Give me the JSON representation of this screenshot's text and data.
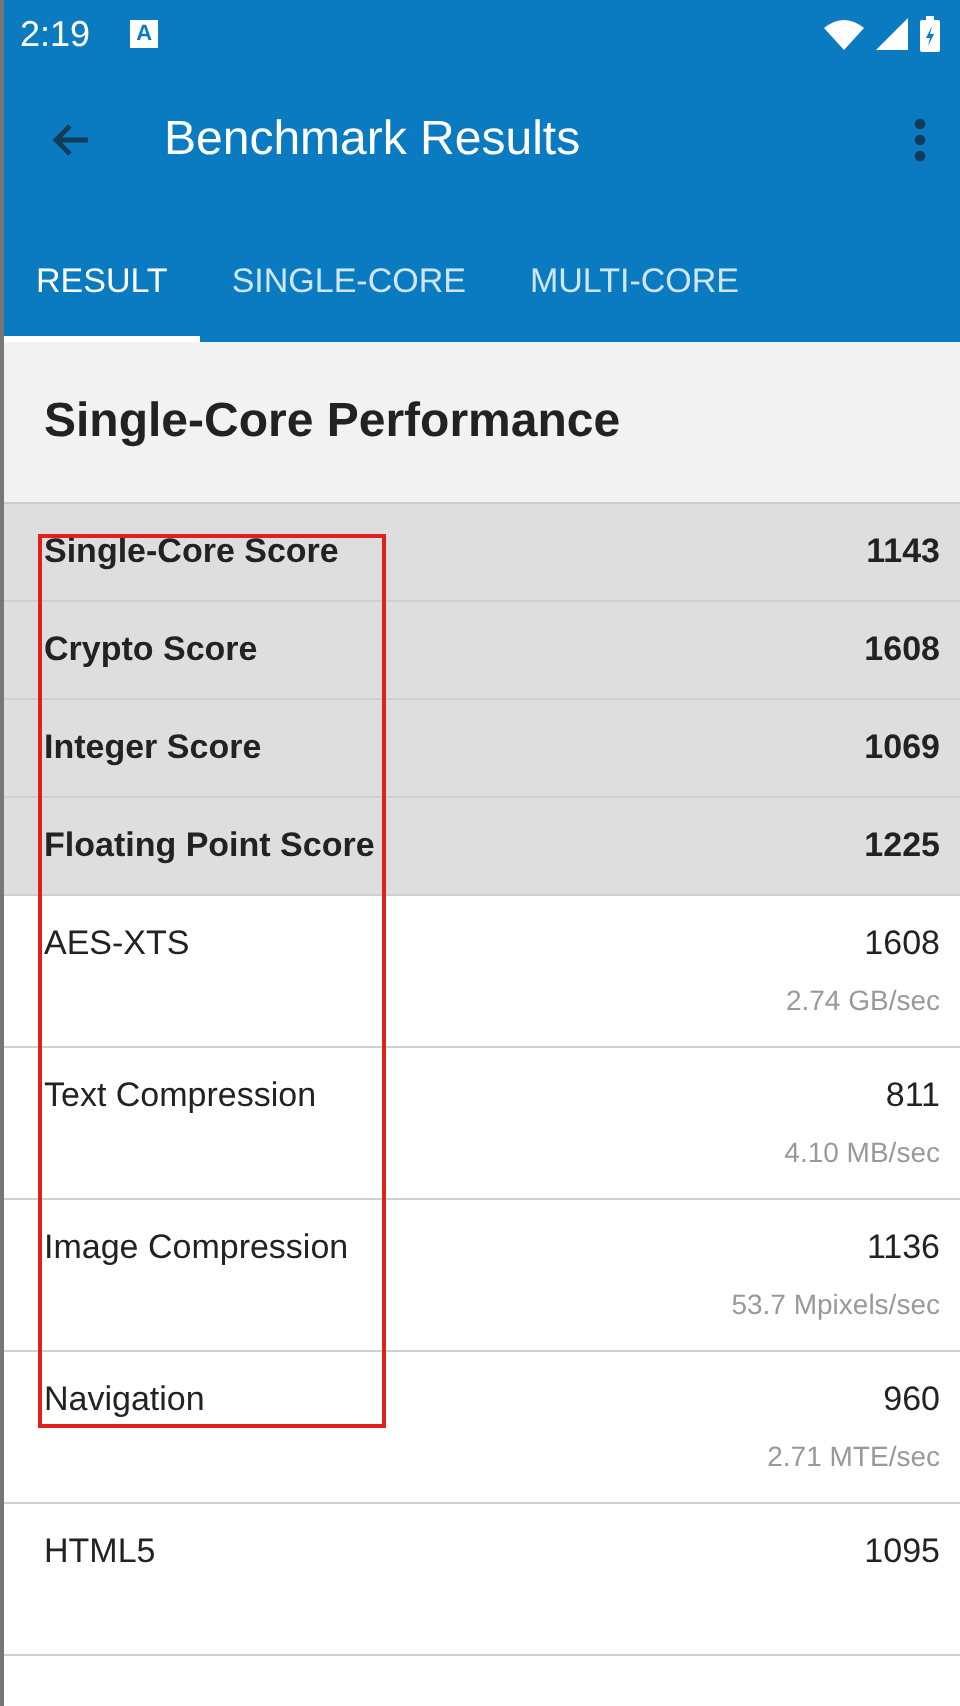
{
  "status_bar": {
    "time": "2:19",
    "notification": "A"
  },
  "app_bar": {
    "title": "Benchmark Results"
  },
  "tabs": [
    {
      "label": "RESULT",
      "selected": true
    },
    {
      "label": "SINGLE-CORE",
      "selected": false
    },
    {
      "label": "MULTI-CORE",
      "selected": false
    }
  ],
  "section": {
    "title": "Single-Core Performance"
  },
  "rows": [
    {
      "kind": "score",
      "name": "Single-Core Score",
      "value": "1143"
    },
    {
      "kind": "score",
      "name": "Crypto Score",
      "value": "1608"
    },
    {
      "kind": "score",
      "name": "Integer Score",
      "value": "1069"
    },
    {
      "kind": "score",
      "name": "Floating Point Score",
      "value": "1225"
    },
    {
      "kind": "test",
      "name": "AES-XTS",
      "value": "1608",
      "rate": "2.74 GB/sec"
    },
    {
      "kind": "test",
      "name": "Text Compression",
      "value": "811",
      "rate": "4.10 MB/sec"
    },
    {
      "kind": "test",
      "name": "Image Compression",
      "value": "1136",
      "rate": "53.7 Mpixels/sec"
    },
    {
      "kind": "test",
      "name": "Navigation",
      "value": "960",
      "rate": "2.71 MTE/sec"
    },
    {
      "kind": "test",
      "name": "HTML5",
      "value": "1095"
    }
  ],
  "annotation": {
    "kind": "frame"
  }
}
